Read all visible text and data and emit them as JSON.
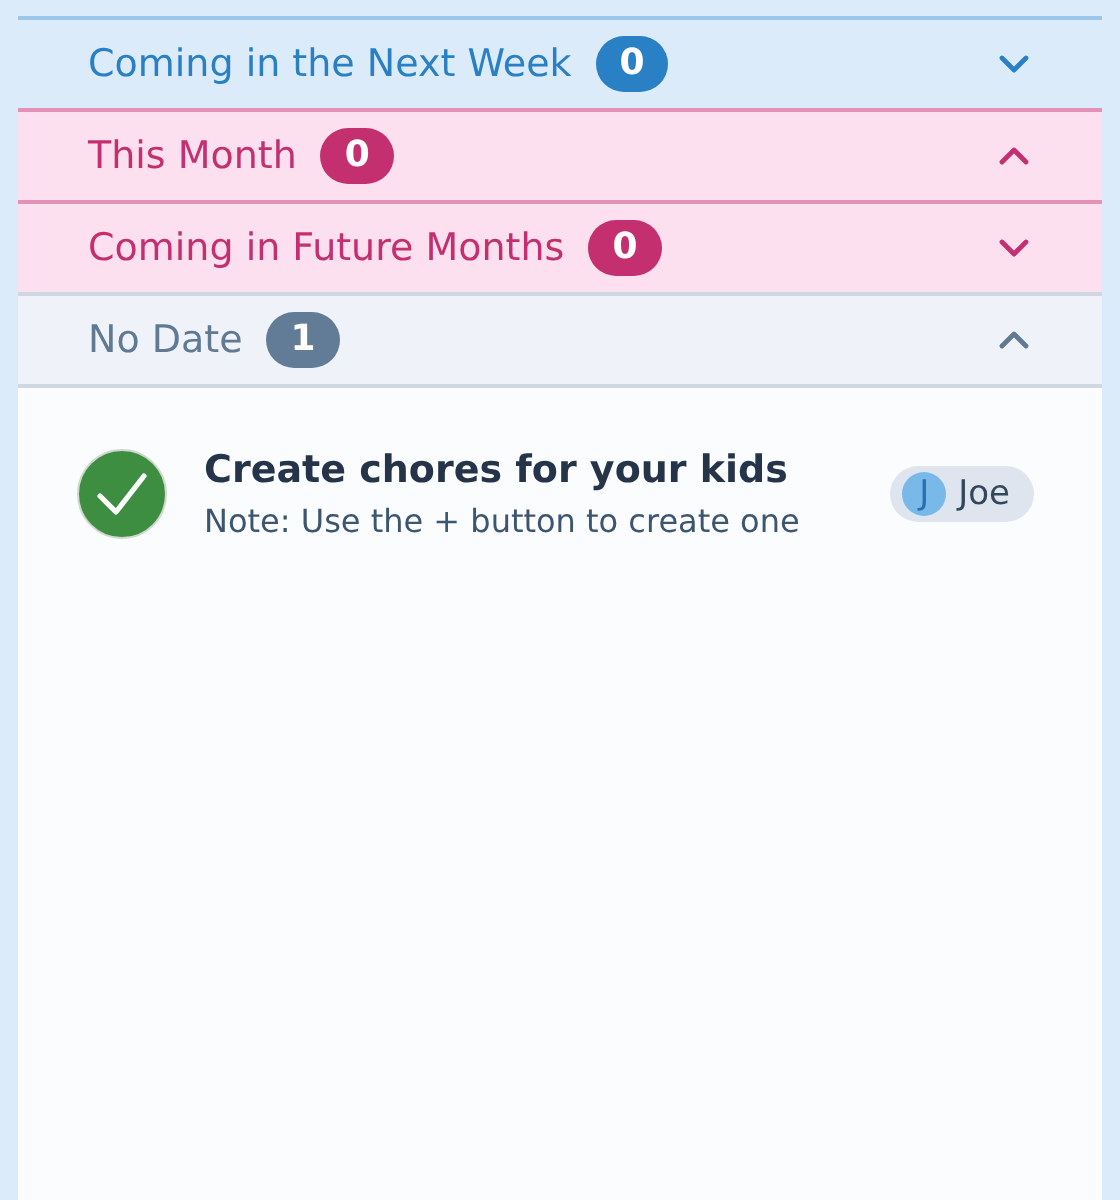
{
  "sections": [
    {
      "title": "Coming in the Next Week",
      "count": "0",
      "kind": "week",
      "expanded": false
    },
    {
      "title": "This Month",
      "count": "0",
      "kind": "month",
      "expanded": true
    },
    {
      "title": "Coming in Future Months",
      "count": "0",
      "kind": "month",
      "expanded": false
    },
    {
      "title": "No Date",
      "count": "1",
      "kind": "nodate",
      "expanded": true
    }
  ],
  "tasks": [
    {
      "title": "Create chores for your kids",
      "note": "Note: Use the + button to create one",
      "done": true,
      "assignee": {
        "initial": "J",
        "name": "Joe"
      }
    }
  ]
}
